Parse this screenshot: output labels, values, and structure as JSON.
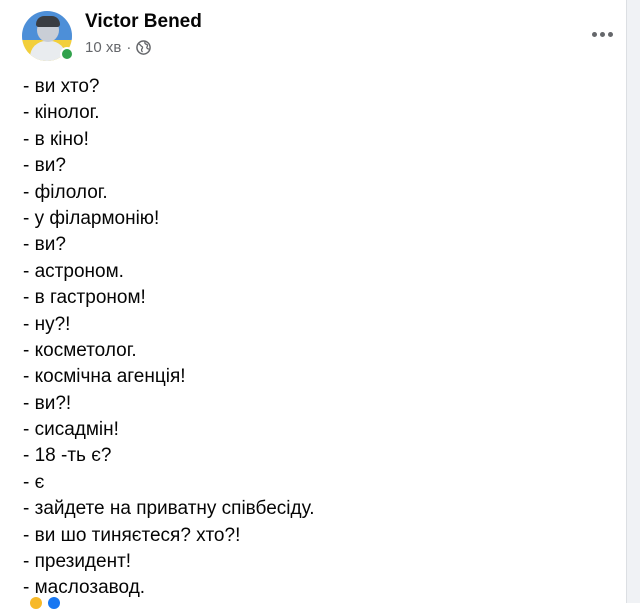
{
  "post": {
    "author": "Victor Bened",
    "time": "10 хв",
    "separator": "·",
    "privacy_icon": "globe-icon",
    "more_icon": "more-horizontal-icon",
    "lines": [
      "- ви хто?",
      "- кінолог.",
      "- в кіно!",
      "- ви?",
      "- філолог.",
      "- у філармонію!",
      "- ви?",
      "- астроном.",
      "- в гастроном!",
      "- ну?!",
      "- косметолог.",
      "- космічна агенція!",
      "- ви?!",
      "- сисадмін!",
      "- 18 -ть є?",
      "- є",
      "- зайдете на приватну співбесіду.",
      "- ви шо тиняєтеся? хто?!",
      "- президент!",
      "- маслозавод."
    ]
  },
  "colors": {
    "text": "#050505",
    "secondary_text": "#65676b",
    "online": "#31a24c",
    "page_background": "#f0f2f5"
  }
}
